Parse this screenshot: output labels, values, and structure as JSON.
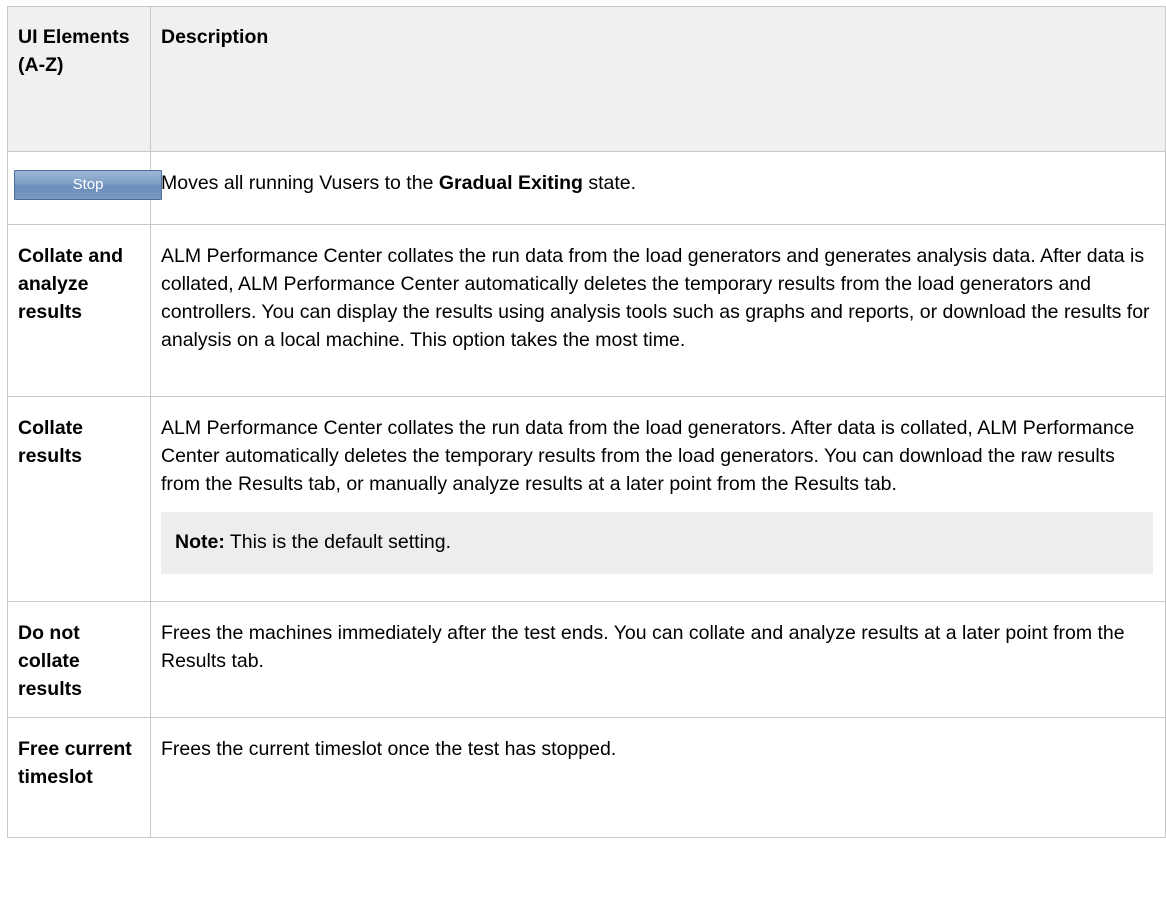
{
  "table": {
    "headers": {
      "col1": "UI Elements (A-Z)",
      "col2": "Description"
    },
    "rows": [
      {
        "element_button_label": "Stop",
        "desc_before": "Moves all running Vusers to the ",
        "desc_bold": "Gradual Exiting",
        "desc_after": " state."
      },
      {
        "element": "Collate and analyze results",
        "description": "ALM Performance Center collates the run data from the load generators and generates analysis data. After data is collated, ALM Performance Center automatically deletes the temporary results from the load generators and controllers. You can display the results using analysis tools such as graphs and reports, or download the results for analysis on a local machine. This option takes the most time."
      },
      {
        "element": "Collate results",
        "description": "ALM Performance Center collates the run data from the load generators. After data is collated, ALM Performance Center automatically deletes the temporary results from the load generators. You can download the raw results from the Results tab, or manually analyze results at a later point from the Results tab.",
        "note_label": "Note:",
        "note_text": " This is the default setting."
      },
      {
        "element": "Do not collate results",
        "description": "Frees the machines immediately after the test ends. You can collate and analyze results at a later point from the Results tab."
      },
      {
        "element": "Free current timeslot",
        "description": "Frees the current timeslot once the test has stopped."
      }
    ]
  },
  "colors": {
    "header_bg": "#f0f0f0",
    "border": "#c8c8c8",
    "note_bg": "#ededed",
    "stop_button": "#7e9ec5"
  }
}
